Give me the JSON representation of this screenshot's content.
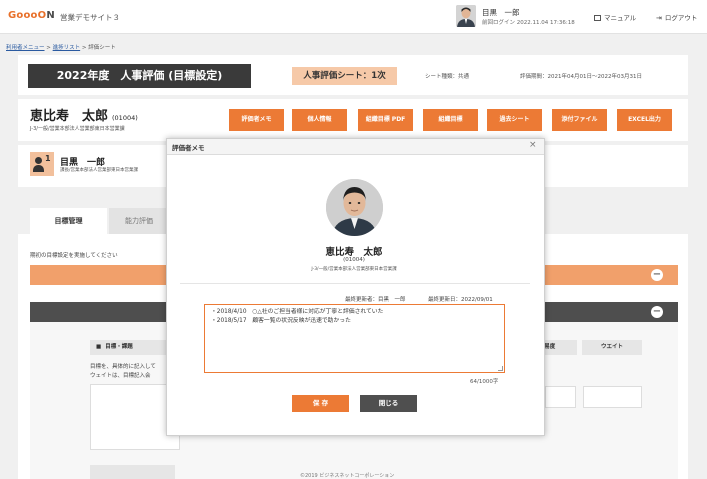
{
  "app": {
    "logo_primary": "GoooO",
    "logo_suffix": "N",
    "site_name": "営業デモサイト３"
  },
  "header": {
    "user_name": "目黒　一郎",
    "last_login": "前回ログイン 2022.11.04 17:36:18",
    "manual_label": "マニュアル",
    "logout_label": "ログアウト"
  },
  "breadcrumb": {
    "items": [
      "利用者メニュー",
      "進捗リスト",
      "評価シート"
    ],
    "separator": ">"
  },
  "title_band": {
    "year_title": "2022年度　人事評価 (目標設定)",
    "sheet_label": "人事評価シート：1次",
    "sheet_kind": "シート種類：共通",
    "period": "評価期間：2021年04月01日～2022年03月31日"
  },
  "employee": {
    "name": "恵比寿　太郎",
    "id": "(01004)",
    "dept": "J-3/一般/営業本部法人営業部東日本営業課"
  },
  "action_buttons": [
    {
      "label": "評価者メモ"
    },
    {
      "label": "個人情報"
    },
    {
      "label": "組織目標 PDF"
    },
    {
      "label": "組織目標"
    },
    {
      "label": "過去シート"
    },
    {
      "label": "添付ファイル"
    },
    {
      "label": "EXCEL出力"
    }
  ],
  "evaluator": {
    "rank": "1",
    "name": "目黒　一郎",
    "dept": "課長/営業本部法人営業部東日本営業課"
  },
  "tabs": [
    {
      "label": "目標管理",
      "active": true
    },
    {
      "label": "能力評価",
      "active": false
    }
  ],
  "content": {
    "notice": "期初の目標設定を実施してください",
    "goal_header": "目標・課題",
    "goal_desc_1": "目標を、具体的に記入して",
    "goal_desc_2": "ウェイトは、目標記入会",
    "col_difficulty": "難易度",
    "col_weight": "ウエイト"
  },
  "footer": {
    "copyright": "©2019 ビジネスネットコーポレーション"
  },
  "modal": {
    "title": "評価者メモ",
    "close_glyph": "×",
    "name": "恵比寿　太郎",
    "id": "(01004)",
    "dept": "J-3/一般/営業本部法人営業部東日本営業課",
    "last_updater": "最終更新者：目黒　一郎",
    "last_updated": "最終更新日：2022/09/01",
    "memo_lines": [
      "・2018/4/10　○△社のご担当者様に対応が丁寧と評価されていた",
      "・2018/5/17　顧客一覧の状況反映が迅速で助かった"
    ],
    "char_count": "64/1000字",
    "save_label": "保 存",
    "close_label": "閉じる"
  },
  "colors": {
    "accent_orange": "#ec7a35",
    "dark_band": "#3a3a3a",
    "light_orange": "#f6c9a8"
  }
}
